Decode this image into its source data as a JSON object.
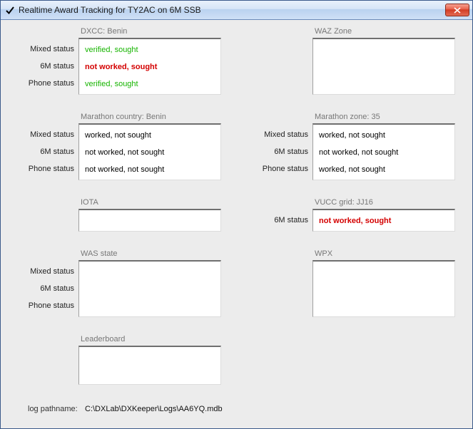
{
  "window": {
    "title": "Realtime Award Tracking for TY2AC on 6M SSB"
  },
  "dxcc": {
    "header": "DXCC: Benin",
    "labels": {
      "mixed": "Mixed status",
      "sixm": "6M status",
      "phone": "Phone status"
    },
    "mixed": "verified, sought",
    "sixm": "not worked, sought",
    "phone": "verified, sought"
  },
  "waz": {
    "header": "WAZ Zone"
  },
  "marathon_country": {
    "header": "Marathon country: Benin",
    "labels": {
      "mixed": "Mixed status",
      "sixm": "6M status",
      "phone": "Phone status"
    },
    "mixed": "worked, not sought",
    "sixm": "not worked, not sought",
    "phone": "not worked, not sought"
  },
  "marathon_zone": {
    "header": "Marathon zone: 35",
    "labels": {
      "mixed": "Mixed status",
      "sixm": "6M status",
      "phone": "Phone status"
    },
    "mixed": "worked, not sought",
    "sixm": "not worked, not sought",
    "phone": "worked, not sought"
  },
  "iota": {
    "header": "IOTA"
  },
  "vucc": {
    "header": "VUCC grid: JJ16",
    "labels": {
      "sixm": "6M status"
    },
    "sixm": "not worked, sought"
  },
  "was": {
    "header": "WAS state",
    "labels": {
      "mixed": "Mixed status",
      "sixm": "6M status",
      "phone": "Phone status"
    }
  },
  "wpx": {
    "header": "WPX"
  },
  "leaderboard": {
    "header": "Leaderboard"
  },
  "footer": {
    "label": "log pathname:",
    "value": "C:\\DXLab\\DXKeeper\\Logs\\AA6YQ.mdb"
  }
}
